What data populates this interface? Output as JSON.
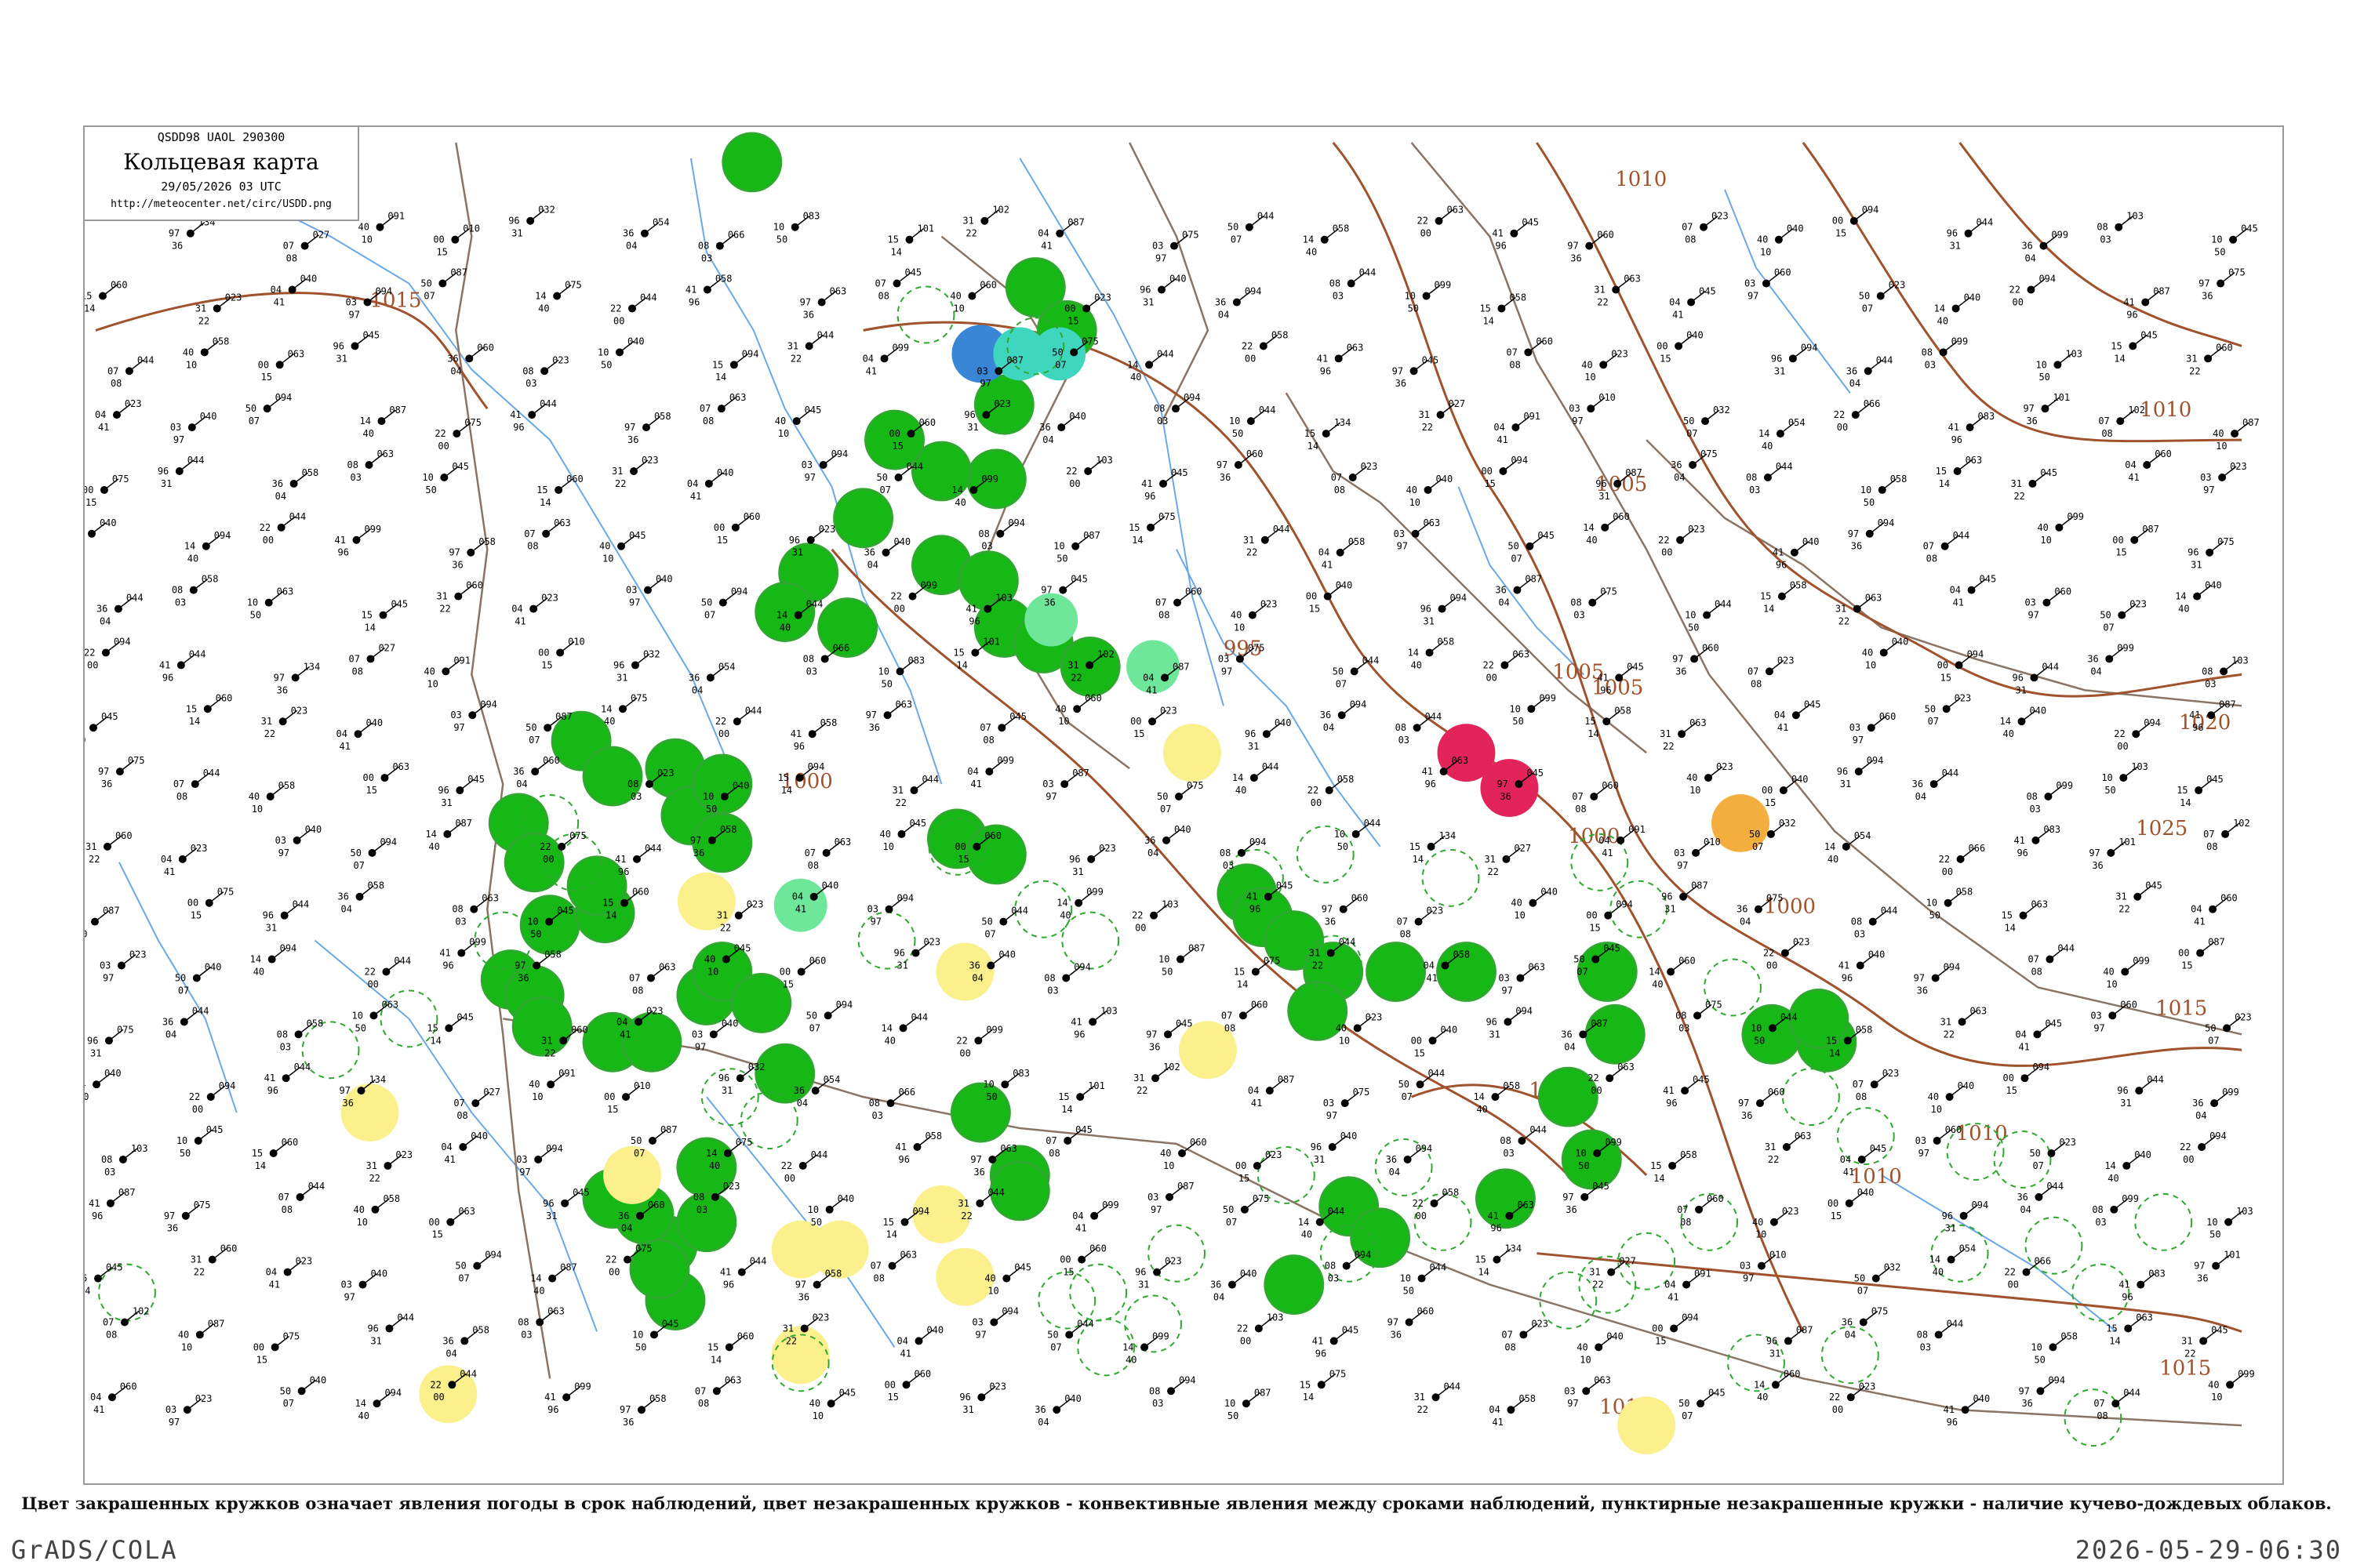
{
  "header": {
    "code": "QSDD98  UAOL  290300",
    "title": "Кольцевая карта",
    "datetime": "29/05/2026 03 UTC",
    "url": "http://meteocenter.net/circ/USDD.png"
  },
  "caption": "Цвет закрашенных кружков означает явления погоды в срок наблюдений, цвет незакрашенных кружков - конвективные явления между сроками наблюдений, пунктирные незакрашенные кружки - наличие кучево-дождевых облаков.",
  "footer": {
    "left": "GrADS/COLA",
    "right": "2026-05-29-06:30"
  },
  "colors": {
    "rain_fill": "#16b816",
    "rain_ring": "#2ea82e",
    "fog_fill": "#fbf08c",
    "snow_fill": "#3a86d6",
    "shower_fill": "#3fd6bf",
    "drizzle_fill": "#6ee79a",
    "thunder_fill": "#e2245a",
    "haze_fill": "#f4ae3d",
    "isobar": "#a0522d",
    "river": "#6aa8e8",
    "frame": "#9a9a9a"
  },
  "isobar_labels": [
    "1015",
    "1010",
    "1005",
    "1000",
    "995",
    "1000",
    "1005",
    "1010",
    "1015",
    "1020",
    "1025",
    "1015",
    "1010",
    "1010",
    "1000",
    "1005",
    "1010",
    "1000"
  ],
  "station_numbers": [
    "134",
    "027",
    "091",
    "010",
    "032",
    "054",
    "066",
    "083",
    "101",
    "102",
    "087",
    "075",
    "044",
    "058",
    "063",
    "045",
    "060",
    "023",
    "040",
    "094",
    "044",
    "099",
    "103",
    "045",
    "060",
    "023",
    "040",
    "094",
    "087",
    "075",
    "044",
    "058",
    "063",
    "045",
    "060",
    "023",
    "040",
    "094",
    "044",
    "099",
    "058",
    "063",
    "045",
    "060",
    "023",
    "040",
    "094",
    "087",
    "075",
    "044",
    "058",
    "063",
    "045",
    "060",
    "023",
    "040",
    "094",
    "044",
    "099",
    "087",
    "075",
    "044",
    "058",
    "063",
    "045",
    "060",
    "023",
    "040",
    "094",
    "044",
    "099",
    "103",
    "045",
    "060",
    "023",
    "040",
    "094",
    "087",
    "075",
    "044",
    "058",
    "063",
    "045",
    "060",
    "023",
    "040",
    "094",
    "044"
  ],
  "station_small": [
    "97",
    "07",
    "40",
    "00",
    "96",
    "36",
    "08",
    "10",
    "15",
    "31",
    "04",
    "03",
    "50",
    "14",
    "22",
    "41"
  ]
}
